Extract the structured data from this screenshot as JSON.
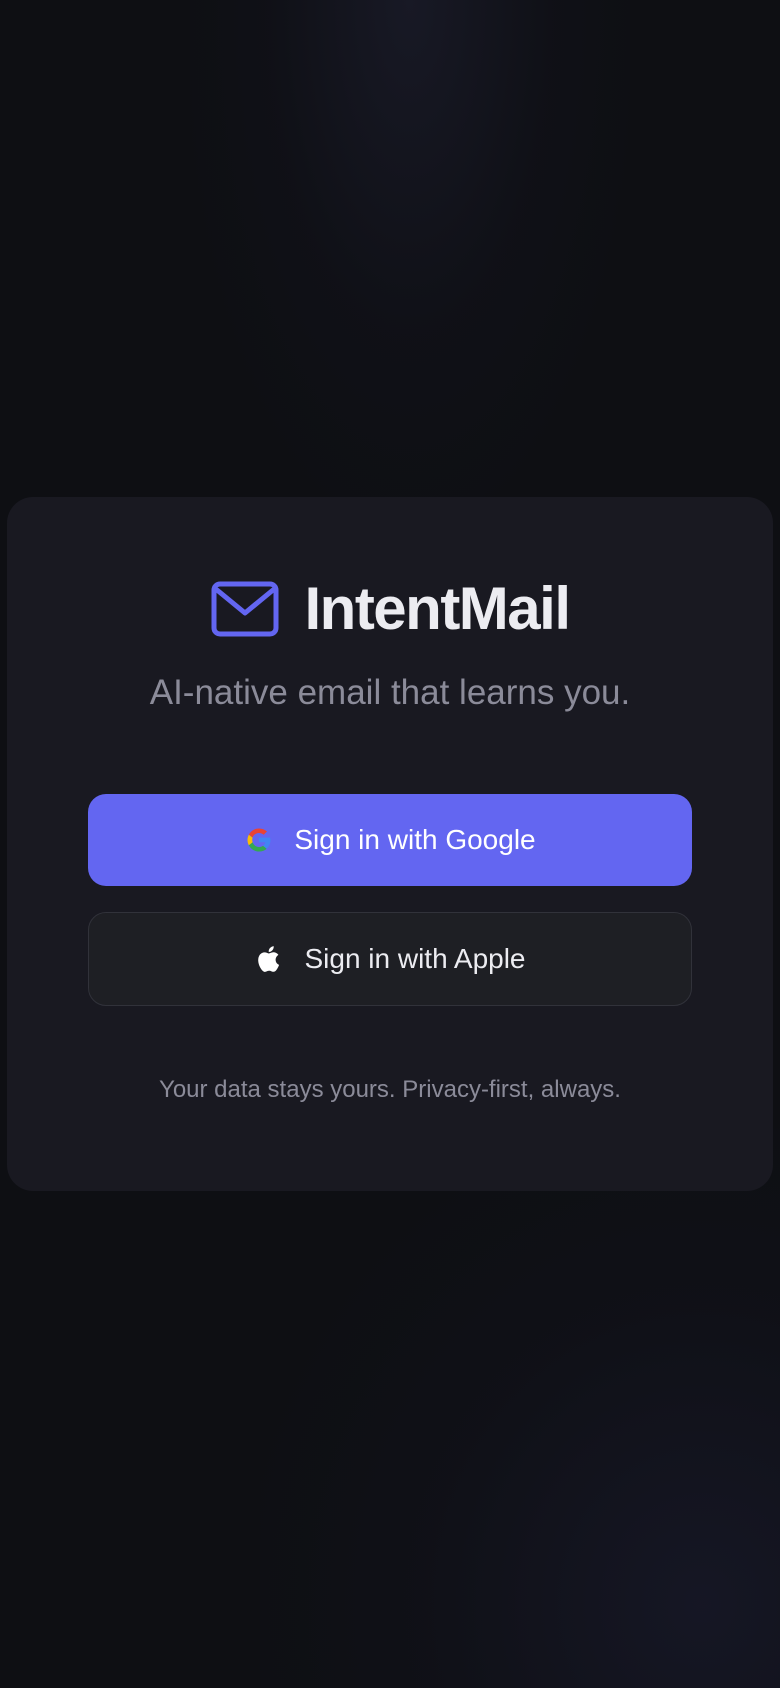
{
  "brand": {
    "name": "IntentMail",
    "icon": "mail-icon"
  },
  "tagline": "AI-native email that learns you.",
  "auth": {
    "google": {
      "label": "Sign in with Google",
      "icon": "google-icon"
    },
    "apple": {
      "label": "Sign in with Apple",
      "icon": "apple-icon"
    }
  },
  "footer_note": "Your data stays yours. Privacy-first, always.",
  "colors": {
    "accent": "#6366f1",
    "background": "#0e0f13",
    "card": "#191921",
    "text_primary": "#ececf1",
    "text_muted": "#8b8b99"
  }
}
